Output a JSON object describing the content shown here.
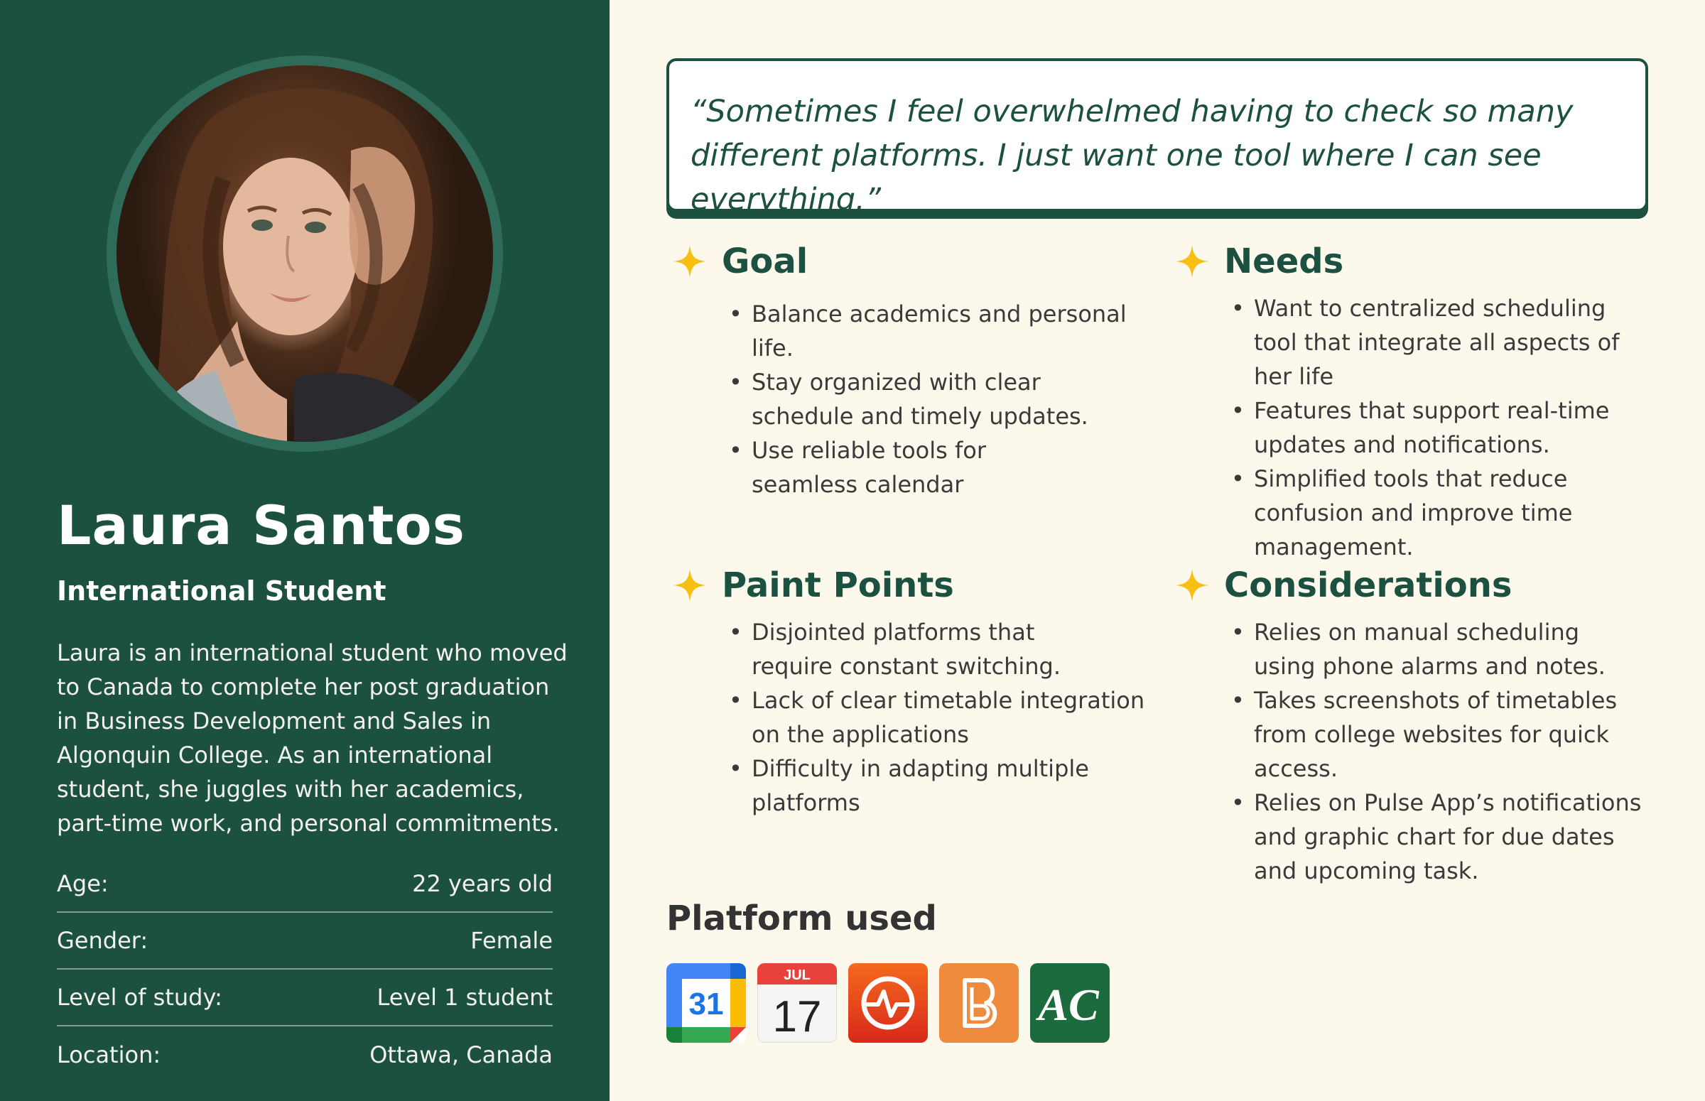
{
  "persona": {
    "name": "Laura Santos",
    "role": "International Student",
    "bio": "Laura is an international student who moved to Canada to complete her post graduation in Business Development and Sales in Algonquin College. As an international student, she juggles with her academics, part-time work, and personal commitments.",
    "facts": [
      {
        "label": "Age:",
        "value": "22 years old"
      },
      {
        "label": "Gender:",
        "value": "Female"
      },
      {
        "label": "Level of study:",
        "value": "Level 1 student"
      },
      {
        "label": "Location:",
        "value": "Ottawa, Canada"
      }
    ]
  },
  "quote": "“Sometimes I feel overwhelmed having to check so many different platforms. I just want one tool where I can see everything.”",
  "sections": {
    "goal": {
      "title": "Goal",
      "items": [
        "Balance academics and personal life.",
        "Stay organized with clear schedule and timely updates.",
        "Use reliable tools for seamless calendar"
      ]
    },
    "needs": {
      "title": "Needs",
      "items": [
        "Want to centralized scheduling tool that integrate all aspects of her life",
        "Features that support real-time updates and notifications.",
        "Simplified tools that reduce confusion and improve time management."
      ]
    },
    "pain_points": {
      "title": "Paint Points",
      "items": [
        "Disjointed platforms that require constant switching.",
        "Lack of clear timetable integration on the applications",
        "Difficulty in adapting multiple platforms"
      ]
    },
    "considerations": {
      "title": "Considerations",
      "items": [
        "Relies on manual scheduling using phone alarms and notes.",
        "Takes screenshots of timetables from college websites for quick access.",
        "Relies on Pulse App’s notifications and graphic chart for due dates and upcoming task."
      ]
    }
  },
  "platforms": {
    "title": "Platform used",
    "apps": [
      {
        "icon": "google-calendar-icon",
        "text": "31"
      },
      {
        "icon": "apple-calendar-icon",
        "month": "JUL",
        "day": "17"
      },
      {
        "icon": "pulse-app-icon"
      },
      {
        "icon": "brightspace-icon"
      },
      {
        "icon": "algonquin-college-icon",
        "text": "AC"
      }
    ]
  },
  "colors": {
    "primary_green": "#1c5040",
    "background": "#fcf9ec",
    "star_yellow": "#f6bf12"
  }
}
